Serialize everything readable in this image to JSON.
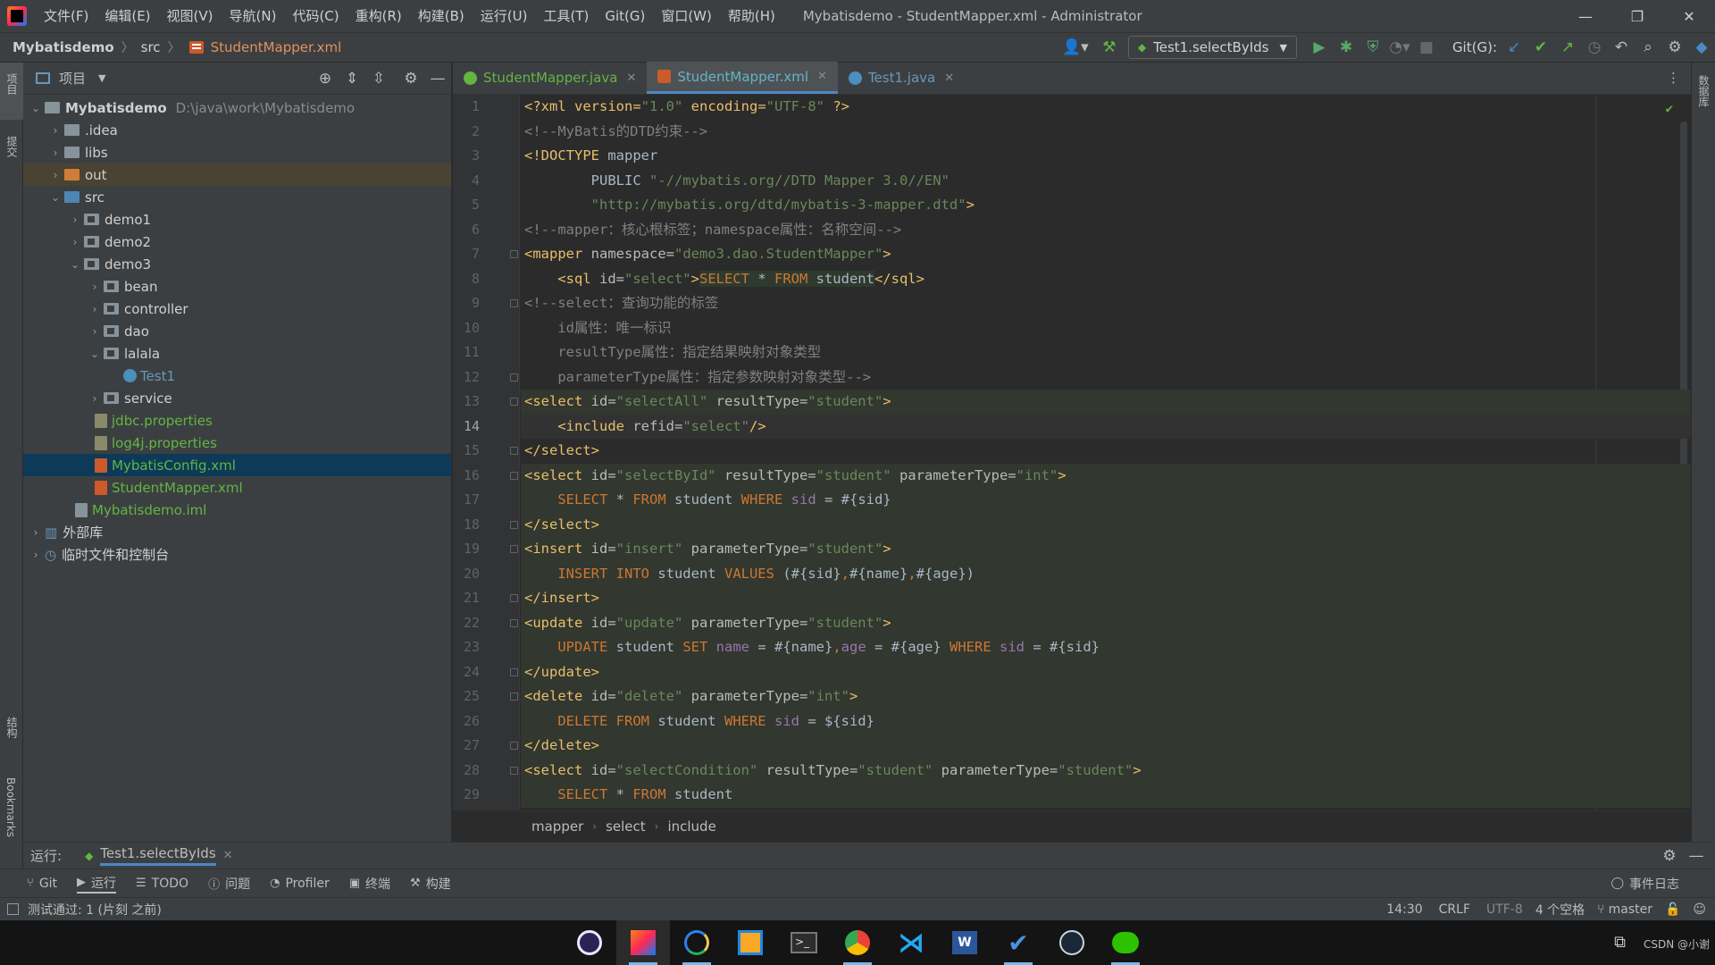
{
  "titlebar": {
    "menu": [
      "文件(F)",
      "编辑(E)",
      "视图(V)",
      "导航(N)",
      "代码(C)",
      "重构(R)",
      "构建(B)",
      "运行(U)",
      "工具(T)",
      "Git(G)",
      "窗口(W)",
      "帮助(H)"
    ],
    "window_title": "Mybatisdemo - StudentMapper.xml - Administrator"
  },
  "navbar": {
    "project": "Mybatisdemo",
    "folder": "src",
    "file": "StudentMapper.xml",
    "run_config": "Test1.selectByIds",
    "git_label": "Git(G):"
  },
  "left_stripe": {
    "project_label": "项目",
    "commit_label": "提交",
    "structure_label": "结构",
    "bookmarks_label": "Bookmarks"
  },
  "right_stripe": {
    "db_label": "数据库"
  },
  "project": {
    "header": "项目",
    "root_name": "Mybatisdemo",
    "root_path": "D:\\java\\work\\Mybatisdemo",
    "items": {
      "idea": ".idea",
      "libs": "libs",
      "out": "out",
      "src": "src",
      "demo1": "demo1",
      "demo2": "demo2",
      "demo3": "demo3",
      "bean": "bean",
      "controller": "controller",
      "dao": "dao",
      "lalala": "lalala",
      "test1": "Test1",
      "service": "service",
      "jdbc": "jdbc.properties",
      "log4j": "log4j.properties",
      "mybatisconfig": "MybatisConfig.xml",
      "studentmapper": "StudentMapper.xml",
      "iml": "Mybatisdemo.iml",
      "external": "外部库",
      "scratch": "临时文件和控制台"
    }
  },
  "tabs": [
    {
      "label": "StudentMapper.java"
    },
    {
      "label": "StudentMapper.xml"
    },
    {
      "label": "Test1.java"
    }
  ],
  "lines": [
    "1",
    "2",
    "3",
    "4",
    "5",
    "6",
    "7",
    "8",
    "9",
    "10",
    "11",
    "12",
    "13",
    "14",
    "15",
    "16",
    "17",
    "18",
    "19",
    "20",
    "21",
    "22",
    "23",
    "24",
    "25",
    "26",
    "27",
    "28",
    "29"
  ],
  "code": {
    "l1a": "<?xml version=",
    "l1b": "\"1.0\"",
    "l1c": " encoding=",
    "l1d": "\"UTF-8\"",
    "l1e": " ?>",
    "l2": "<!--MyBatis的DTD约束-->",
    "l3a": "<!DOCTYPE",
    "l3b": " mapper",
    "l4a": "        PUBLIC ",
    "l4b": "\"-//mybatis.org//DTD Mapper 3.0//EN\"",
    "l5a": "        ",
    "l5b": "\"http://mybatis.org/dtd/mybatis-3-mapper.dtd\"",
    "l5c": ">",
    "l6": "<!--mapper：核心根标签；namespace属性：名称空间-->",
    "l7a": "<mapper",
    "l7b": " namespace=",
    "l7c": "\"demo3.dao.StudentMapper\"",
    "l7d": ">",
    "l8a": "    <sql",
    "l8b": " id=",
    "l8c": "\"select\"",
    "l8d": ">",
    "l8e": "SELECT",
    "l8f": " * ",
    "l8g": "FROM",
    "l8h": " student",
    "l8i": "</sql>",
    "l9": "<!--select：查询功能的标签",
    "l10": "    id属性：唯一标识",
    "l11": "    resultType属性：指定结果映射对象类型",
    "l12": "    parameterType属性：指定参数映射对象类型-->",
    "l13a": "<select",
    "l13b": " id=",
    "l13c": "\"selectAll\"",
    "l13d": " resultType=",
    "l13e": "\"student\"",
    "l13f": ">",
    "l14a": "    <include",
    "l14b": " refid=",
    "l14c": "\"select\"",
    "l14d": "/>",
    "l15": "</select>",
    "l16a": "<select",
    "l16b": " id=",
    "l16c": "\"selectById\"",
    "l16d": " resultType=",
    "l16e": "\"student\"",
    "l16f": " parameterType=",
    "l16g": "\"int\"",
    "l16h": ">",
    "l17a": "    SELECT",
    "l17b": " * ",
    "l17c": "FROM",
    "l17d": " student ",
    "l17e": "WHERE",
    "l17f": " sid",
    "l17g": " = #{sid}",
    "l18": "</select>",
    "l19a": "<insert",
    "l19b": " id=",
    "l19c": "\"insert\"",
    "l19d": " parameterType=",
    "l19e": "\"student\"",
    "l19f": ">",
    "l20a": "    INSERT INTO",
    "l20b": " student ",
    "l20c": "VALUES",
    "l20d": " (#{sid}",
    "l20e": ",",
    "l20f": "#{name}",
    "l20g": ",",
    "l20h": "#{age})",
    "l21": "</insert>",
    "l22a": "<update",
    "l22b": " id=",
    "l22c": "\"update\"",
    "l22d": " parameterType=",
    "l22e": "\"student\"",
    "l22f": ">",
    "l23a": "    UPDATE",
    "l23b": " student ",
    "l23c": "SET",
    "l23d": " name",
    "l23e": " = #{name}",
    "l23f": ",",
    "l23g": "age",
    "l23h": " = #{age} ",
    "l23i": "WHERE",
    "l23j": " sid",
    "l23k": " = #{sid}",
    "l24": "</update>",
    "l25a": "<delete",
    "l25b": " id=",
    "l25c": "\"delete\"",
    "l25d": " parameterType=",
    "l25e": "\"int\"",
    "l25f": ">",
    "l26a": "    DELETE FROM",
    "l26b": " student ",
    "l26c": "WHERE",
    "l26d": " sid",
    "l26e": " = ${sid}",
    "l27": "</delete>",
    "l28a": "<select",
    "l28b": " id=",
    "l28c": "\"selectCondition\"",
    "l28d": " resultType=",
    "l28e": "\"student\"",
    "l28f": " parameterType=",
    "l28g": "\"student\"",
    "l28h": ">",
    "l29a": "    SELECT",
    "l29b": " * ",
    "l29c": "FROM",
    "l29d": " student"
  },
  "breadcrumb": [
    "mapper",
    "select",
    "include"
  ],
  "runbar": {
    "label": "运行:",
    "tab": "Test1.selectByIds"
  },
  "toolwindows": [
    "Git",
    "运行",
    "TODO",
    "问题",
    "Profiler",
    "终端",
    "构建"
  ],
  "event_log": "事件日志",
  "status": {
    "message": "测试通过: 1 (片刻 之前)",
    "position": "14:30",
    "line_sep": "CRLF",
    "encoding": "UTF-8",
    "indent": "4 个空格",
    "branch": "master"
  },
  "taskbar": {
    "watermark": "CSDN @小谢"
  },
  "colors": {
    "accent": "#4a88c7",
    "selection": "#0d3a58",
    "ok": "#62b543"
  }
}
